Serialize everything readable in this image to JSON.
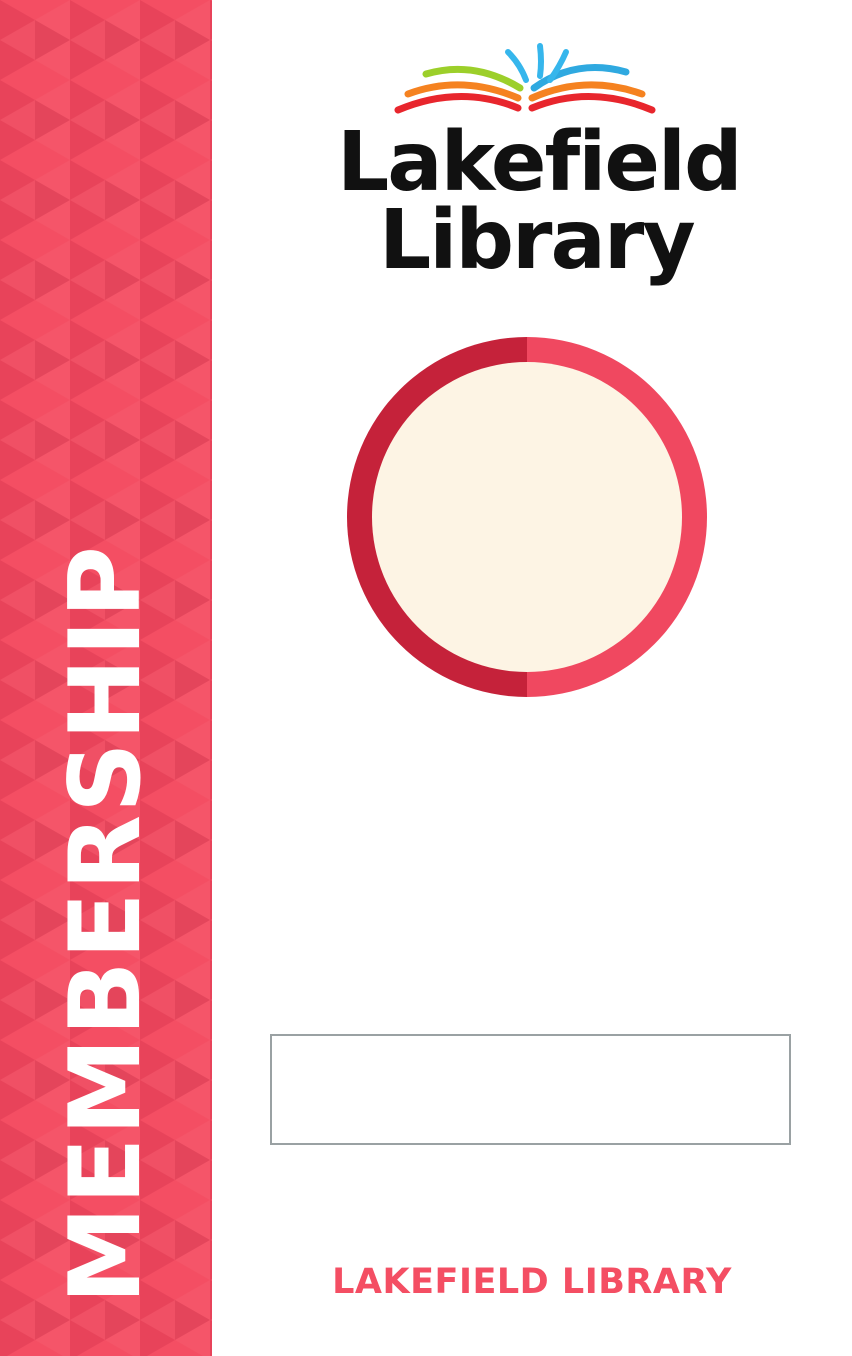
{
  "card": {
    "side_label": "MEMBERSHIP",
    "logo": {
      "icon": "open-book-rainbow-icon",
      "name_line1": "Lakefield",
      "name_line2": "Library"
    },
    "photo_placeholder": "",
    "name_field_value": "",
    "footer_brand": "LAKEFIELD LIBRARY"
  },
  "colors": {
    "band": "#f44e63",
    "band_dark": "#d7374c",
    "ring_left": "#c5223a",
    "ring_right": "#f04860",
    "photo_fill": "#fdf4e4",
    "text_dark": "#111111",
    "footer_text": "#f44e63"
  }
}
